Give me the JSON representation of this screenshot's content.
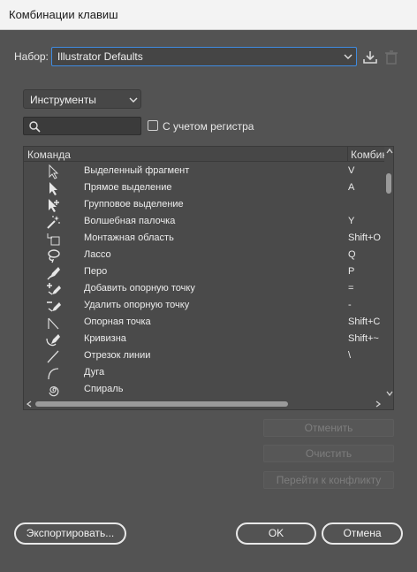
{
  "window": {
    "title": "Комбинации клавиш"
  },
  "set": {
    "label": "Набор:",
    "value": "Illustrator Defaults"
  },
  "category": {
    "value": "Инструменты"
  },
  "search": {
    "placeholder": "",
    "case_label": "С учетом регистра"
  },
  "table": {
    "headers": {
      "command": "Команда",
      "shortcut": "Комбинация"
    },
    "rows": [
      {
        "icon": "selection-arrow-icon",
        "name": "Выделенный фрагмент",
        "key": "V"
      },
      {
        "icon": "direct-selection-icon",
        "name": "Прямое выделение",
        "key": "A"
      },
      {
        "icon": "group-selection-icon",
        "name": "Групповое выделение",
        "key": ""
      },
      {
        "icon": "magic-wand-icon",
        "name": "Волшебная палочка",
        "key": "Y"
      },
      {
        "icon": "artboard-icon",
        "name": "Монтажная область",
        "key": "Shift+O"
      },
      {
        "icon": "lasso-icon",
        "name": "Лассо",
        "key": "Q"
      },
      {
        "icon": "pen-icon",
        "name": "Перо",
        "key": "P"
      },
      {
        "icon": "add-anchor-point-icon",
        "name": "Добавить опорную точку",
        "key": "="
      },
      {
        "icon": "delete-anchor-point-icon",
        "name": "Удалить опорную точку",
        "key": "-"
      },
      {
        "icon": "anchor-point-icon",
        "name": "Опорная точка",
        "key": "Shift+C"
      },
      {
        "icon": "curvature-icon",
        "name": "Кривизна",
        "key": "Shift+~"
      },
      {
        "icon": "line-segment-icon",
        "name": "Отрезок линии",
        "key": "\\"
      },
      {
        "icon": "arc-icon",
        "name": "Дуга",
        "key": ""
      },
      {
        "icon": "spiral-icon",
        "name": "Спираль",
        "key": ""
      }
    ]
  },
  "buttons": {
    "undo": "Отменить",
    "clear": "Очистить",
    "goto_conflict": "Перейти к конфликту",
    "export": "Экспортировать...",
    "ok": "OK",
    "cancel": "Отмена"
  }
}
